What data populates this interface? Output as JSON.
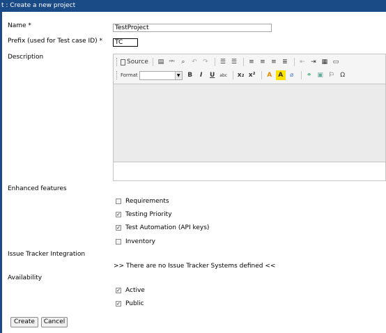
{
  "title": "t : Create a new project",
  "fields": {
    "name_label": "Name *",
    "name_value": "TestProject",
    "prefix_label": "Prefix (used for Test case ID) *",
    "prefix_value": "TC",
    "description_label": "Description"
  },
  "toolbar": {
    "source_label": "Source",
    "format_label": "Format",
    "bold": "B",
    "italic": "I",
    "underline": "U",
    "strike": "abc",
    "subscript": "x₂",
    "superscript": "x²",
    "font_color": "A",
    "bg_color": "A",
    "special_char": "Ω"
  },
  "enhanced": {
    "label": "Enhanced features",
    "items": [
      {
        "label": "Requirements",
        "checked": false
      },
      {
        "label": "Testing Priority",
        "checked": true
      },
      {
        "label": "Test Automation (API keys)",
        "checked": true
      },
      {
        "label": "Inventory",
        "checked": false
      }
    ]
  },
  "issue_tracker": {
    "label": "Issue Tracker Integration",
    "message": ">> There are no Issue Tracker Systems defined <<"
  },
  "availability": {
    "label": "Availability",
    "items": [
      {
        "label": "Active",
        "checked": true
      },
      {
        "label": "Public",
        "checked": true
      }
    ]
  },
  "buttons": {
    "create": "Create",
    "cancel": "Cancel"
  },
  "colors": {
    "titlebar": "#1b4b87",
    "editor_bg": "#ebebeb"
  }
}
